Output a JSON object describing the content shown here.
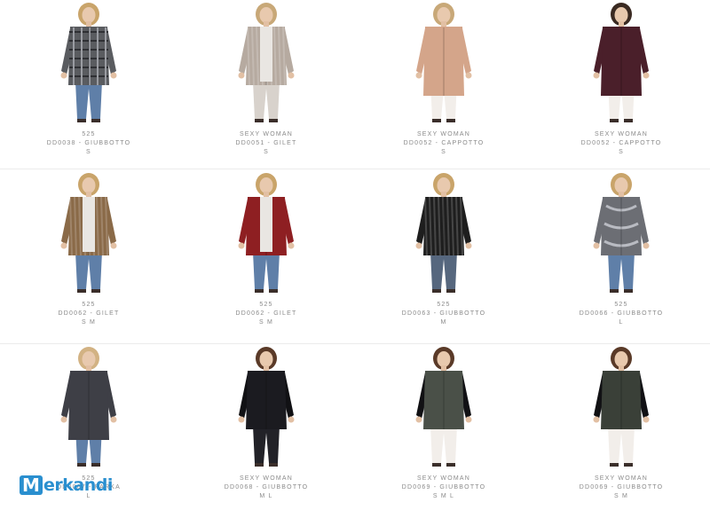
{
  "products": [
    {
      "brand": "525",
      "code": "DD0038 - GIUBBOTTO",
      "sizes": "S",
      "coat": "#5a5c60",
      "pattern": "plaid",
      "pants": "#5f7fa8",
      "hair": "#c9a46a"
    },
    {
      "brand": "SEXY WOMAN",
      "code": "DD0051 - GILET",
      "sizes": "S",
      "coat": "#b6aaa0",
      "pattern": "fur",
      "pants": "#d8d2cc",
      "hair": "#c8a878"
    },
    {
      "brand": "SEXY WOMAN",
      "code": "DD0052 - CAPPOTTO",
      "sizes": "S",
      "coat": "#d4a58a",
      "pattern": "plain",
      "pants": "#f2eeea",
      "hair": "#c8a878"
    },
    {
      "brand": "SEXY WOMAN",
      "code": "DD0052 - CAPPOTTO",
      "sizes": "S",
      "coat": "#4a1f2a",
      "pattern": "plain",
      "pants": "#f2eeea",
      "hair": "#3a2a22"
    },
    {
      "brand": "525",
      "code": "DD0062 - GILET",
      "sizes": "S M",
      "coat": "#8a6a48",
      "pattern": "fur",
      "pants": "#5f7fa8",
      "hair": "#c9a46a"
    },
    {
      "brand": "525",
      "code": "DD0062 - GILET",
      "sizes": "S M",
      "coat": "#8e1f22",
      "pattern": "plain",
      "pants": "#5f7fa8",
      "hair": "#c9a46a"
    },
    {
      "brand": "525",
      "code": "DD0063 - GIUBBOTTO",
      "sizes": "M",
      "coat": "#1e1e1e",
      "pattern": "fur",
      "pants": "#56677e",
      "hair": "#c9a46a"
    },
    {
      "brand": "525",
      "code": "DD0066 - GIUBBOTTO",
      "sizes": "L",
      "coat": "#6c6e74",
      "pattern": "shiny",
      "pants": "#5f7fa8",
      "hair": "#c9a46a"
    },
    {
      "brand": "525",
      "code": "DD0067 - PARKA",
      "sizes": "L",
      "coat": "#3e3f46",
      "pattern": "plain",
      "pants": "#5f7fa8",
      "hair": "#d2b283"
    },
    {
      "brand": "SEXY WOMAN",
      "code": "DD0068 - GIUBBOTTO",
      "sizes": "M L",
      "coat": "#1b1b20",
      "pattern": "sleeves",
      "pants": "#222228",
      "hair": "#5a3a28"
    },
    {
      "brand": "SEXY WOMAN",
      "code": "DD0069 - GIUBBOTTO",
      "sizes": "S M L",
      "coat": "#4a5048",
      "pattern": "sleeves",
      "pants": "#f2eeea",
      "hair": "#5a3a28"
    },
    {
      "brand": "SEXY WOMAN",
      "code": "DD0069 - GIUBBOTTO",
      "sizes": "S M",
      "coat": "#3a4038",
      "pattern": "sleeves",
      "pants": "#f2eeea",
      "hair": "#5a3a28"
    }
  ],
  "watermark": {
    "initial": "M",
    "rest": "erkandi"
  },
  "colors": {
    "text": "#8a8a8a",
    "brand_blue": "#2a8fcf",
    "separator": "#ececec"
  }
}
